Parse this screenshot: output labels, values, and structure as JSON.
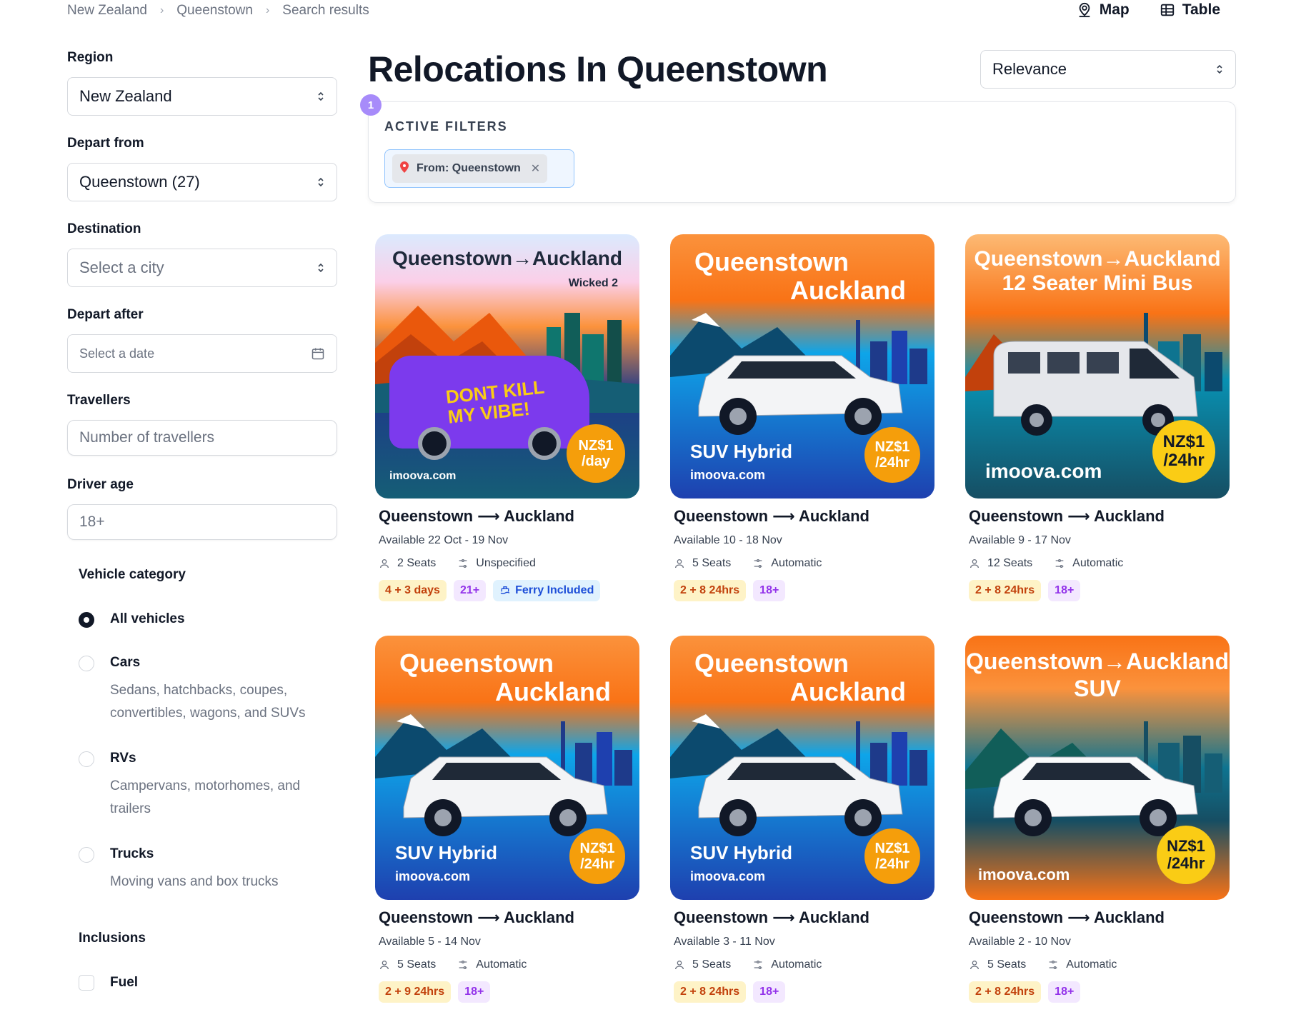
{
  "breadcrumb": [
    "New Zealand",
    "Queenstown",
    "Search results"
  ],
  "view_toggle": {
    "map": "Map",
    "table": "Table"
  },
  "sidebar": {
    "region_label": "Region",
    "region_value": "New Zealand",
    "depart_label": "Depart from",
    "depart_value": "Queenstown (27)",
    "destination_label": "Destination",
    "destination_placeholder": "Select a city",
    "depart_after_label": "Depart after",
    "depart_after_placeholder": "Select a date",
    "travellers_label": "Travellers",
    "travellers_placeholder": "Number of travellers",
    "driver_age_label": "Driver age",
    "driver_age_placeholder": "18+",
    "vehicle_category_label": "Vehicle category",
    "categories": [
      {
        "title": "All vehicles",
        "desc": ""
      },
      {
        "title": "Cars",
        "desc": "Sedans, hatchbacks, coupes, convertibles, wagons, and SUVs"
      },
      {
        "title": "RVs",
        "desc": "Campervans, motorhomes, and trailers"
      },
      {
        "title": "Trucks",
        "desc": "Moving vans and box trucks"
      }
    ],
    "inclusions_label": "Inclusions",
    "inclusions": [
      {
        "title": "Fuel"
      }
    ]
  },
  "main": {
    "title": "Relocations In Queenstown",
    "sort_value": "Relevance",
    "filter_count": "1",
    "active_filters_label": "ACTIVE FILTERS",
    "filter_chip": "From: Queenstown"
  },
  "cards": [
    {
      "img_title_1": "Queenstown→Auckland",
      "img_title_2": "Wicked 2",
      "brand": "imoova.com",
      "price_1": "NZ$1",
      "price_2": "/day",
      "title": "Queenstown ⟶ Auckland",
      "avail": "Available 22 Oct - 19 Nov",
      "seats": "2 Seats",
      "trans": "Unspecified",
      "days": "4 + 3 days",
      "age": "21+",
      "ferry": "Ferry Included",
      "van_text": "DONT KILL MY VIBE!"
    },
    {
      "img_title_1": "Queenstown",
      "img_title_2": "Auckland",
      "sub": "SUV Hybrid",
      "brand": "imoova.com",
      "price_1": "NZ$1",
      "price_2": "/24hr",
      "title": "Queenstown ⟶ Auckland",
      "avail": "Available 10 - 18 Nov",
      "seats": "5 Seats",
      "trans": "Automatic",
      "days": "2 + 8 24hrs",
      "age": "18+"
    },
    {
      "img_title_1": "Queenstown→Auckland",
      "img_title_2": "12 Seater Mini Bus",
      "brand": "imoova.com",
      "price_1": "NZ$1",
      "price_2": "/24hr",
      "title": "Queenstown ⟶ Auckland",
      "avail": "Available 9 - 17 Nov",
      "seats": "12 Seats",
      "trans": "Automatic",
      "days": "2 + 8 24hrs",
      "age": "18+"
    },
    {
      "img_title_1": "Queenstown",
      "img_title_2": "Auckland",
      "sub": "SUV Hybrid",
      "brand": "imoova.com",
      "price_1": "NZ$1",
      "price_2": "/24hr",
      "title": "Queenstown ⟶ Auckland",
      "avail": "Available 5 - 14 Nov",
      "seats": "5 Seats",
      "trans": "Automatic",
      "days": "2 + 9 24hrs",
      "age": "18+"
    },
    {
      "img_title_1": "Queenstown",
      "img_title_2": "Auckland",
      "sub": "SUV Hybrid",
      "brand": "imoova.com",
      "price_1": "NZ$1",
      "price_2": "/24hr",
      "title": "Queenstown ⟶ Auckland",
      "avail": "Available 3 - 11 Nov",
      "seats": "5 Seats",
      "trans": "Automatic",
      "days": "2 + 8 24hrs",
      "age": "18+"
    },
    {
      "img_title_1": "Queenstown→Auckland",
      "img_title_2": "SUV",
      "brand": "imoova.com",
      "price_1": "NZ$1",
      "price_2": "/24hr",
      "title": "Queenstown ⟶ Auckland",
      "avail": "Available 2 - 10 Nov",
      "seats": "5 Seats",
      "trans": "Automatic",
      "days": "2 + 8 24hrs",
      "age": "18+"
    }
  ],
  "colors": {
    "accent": "#a78bfa",
    "price_orange": "#f59e0b",
    "price_yellow": "#facc15"
  }
}
